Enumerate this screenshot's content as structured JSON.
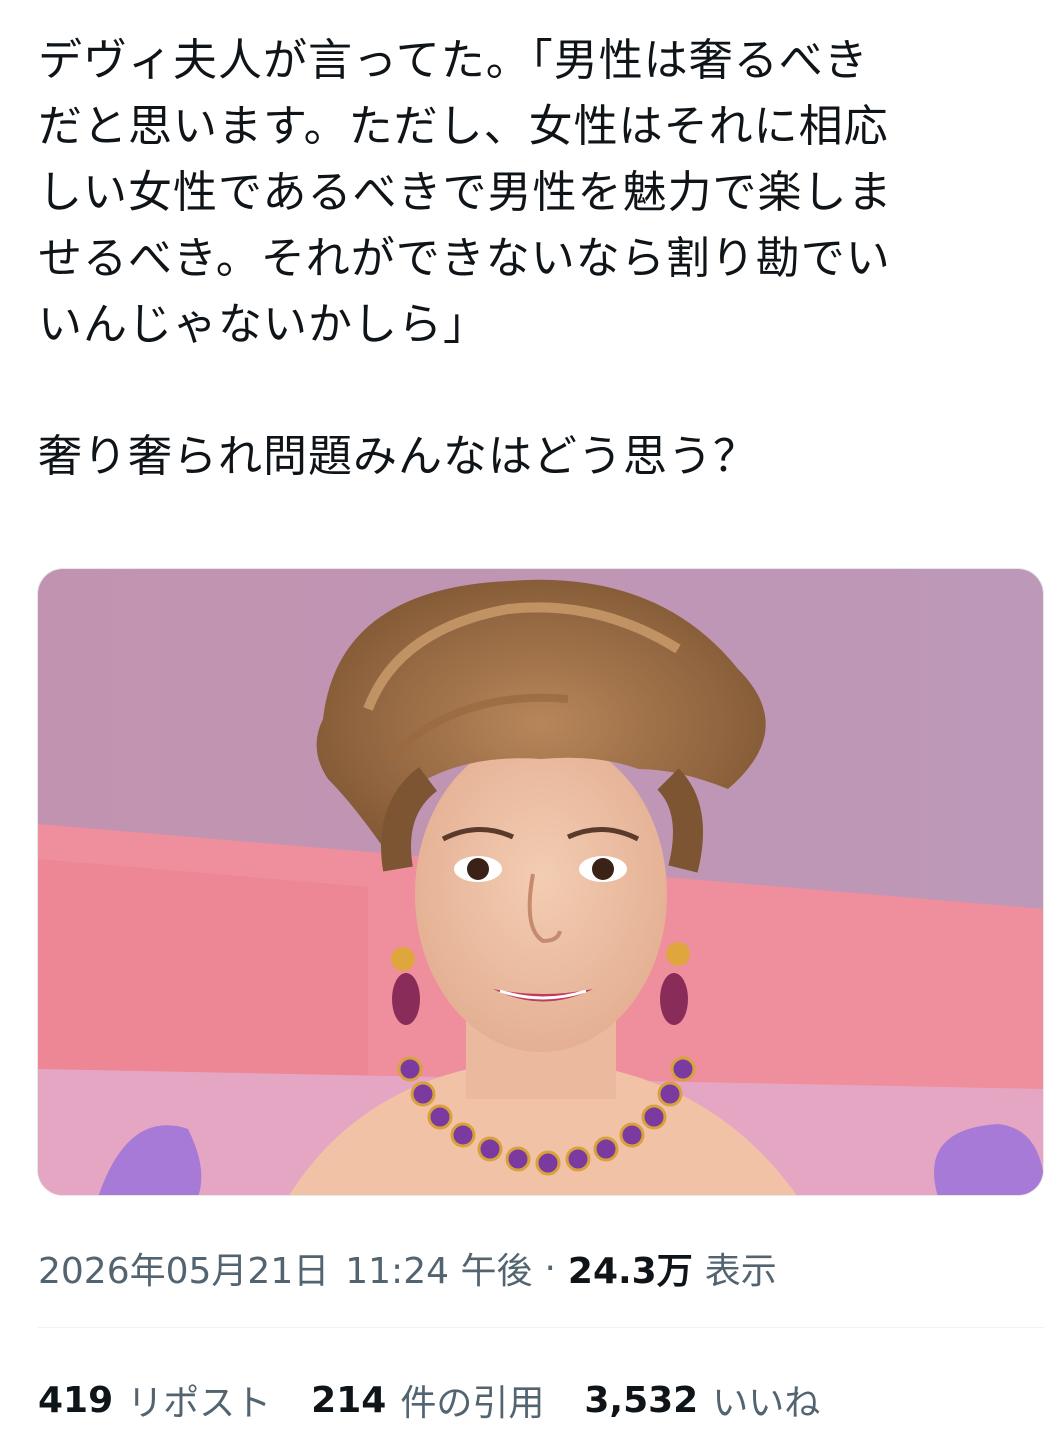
{
  "tweet": {
    "lines": [
      "デヴィ夫人が言ってた。「男性は奢るべき",
      "だと思います。ただし、女性はそれに相応",
      "しい女性であるべきで男性を魅力で楽しま",
      "せるべき。それができないなら割り勘でい",
      "いんじゃないかしら」",
      "奢り奢られ問題みんなはどう思う？"
    ]
  },
  "media": {
    "icon": "photo-portrait",
    "colors": {
      "background_top": "#c797b5",
      "background_band": "#ee8e9b",
      "ribbon": "#a77ad8"
    }
  },
  "meta": {
    "date": "2026年05月21日",
    "time": "11:24 午後",
    "separator": "·",
    "views_count": "24.3万",
    "views_label": "表示"
  },
  "stats": {
    "reposts_count": "419",
    "reposts_label": "リポスト",
    "quotes_count": "214",
    "quotes_label": "件の引用",
    "likes_count": "3,532",
    "likes_label": "いいね"
  }
}
